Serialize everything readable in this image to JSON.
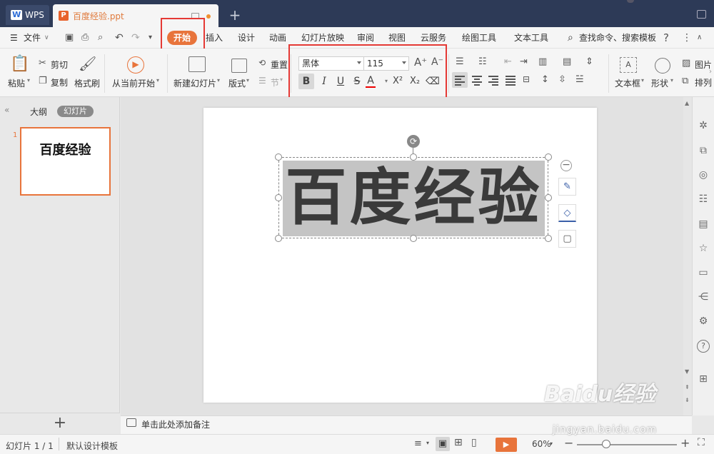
{
  "titlebar": {
    "wps_tab": "WPS",
    "doc_tab": "百度经验.ppt"
  },
  "menubar": {
    "file": "文件",
    "start": "开始",
    "items": [
      "插入",
      "设计",
      "动画",
      "幻灯片放映",
      "审阅",
      "视图",
      "云服务",
      "绘图工具",
      "文本工具"
    ],
    "search": "查找命令、搜索模板"
  },
  "ribbon": {
    "paste": "粘贴",
    "cut": "剪切",
    "copy": "复制",
    "format_painter": "格式刷",
    "play_from_current": "从当前开始",
    "new_slide": "新建幻灯片",
    "layout": "版式",
    "reset": "重置",
    "section": "节",
    "font_name": "黑体",
    "font_size": "115",
    "textbox": "文本框",
    "shape": "形状",
    "picture": "图片",
    "arrange": "排列"
  },
  "left_panel": {
    "tab_outline": "大纲",
    "tab_slides": "幻灯片",
    "slide_number": "1",
    "thumb_text": "百度经验"
  },
  "slide": {
    "title_text": "百度经验"
  },
  "notes": {
    "placeholder": "单击此处添加备注"
  },
  "statusbar": {
    "slide_count": "幻灯片 1 / 1",
    "template": "默认设计模板",
    "zoom": "60%"
  },
  "watermark": {
    "text": "Baidu经验",
    "url": "jingyan.baidu.com"
  },
  "colors": {
    "accent": "#e8743b",
    "titlebar": "#2d3a57",
    "highlight": "#e53935"
  }
}
